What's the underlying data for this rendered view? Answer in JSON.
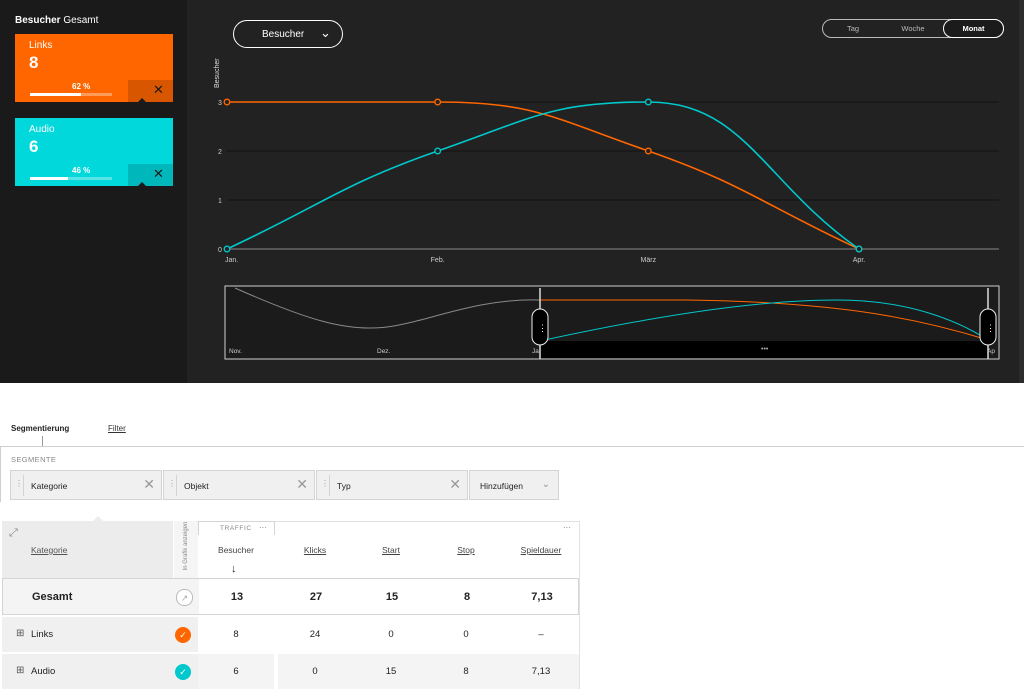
{
  "sidebar": {
    "title_bold": "Besucher",
    "title_rest": "Gesamt",
    "cards": [
      {
        "title": "Links",
        "count": "8",
        "percent": "62 %",
        "fill": 0.62,
        "color": "#ff6600",
        "dark": "#d95600"
      },
      {
        "title": "Audio",
        "count": "6",
        "percent": "46 %",
        "fill": 0.46,
        "color": "#00d8dc",
        "dark": "#00b7bb"
      }
    ]
  },
  "metric_dropdown": {
    "label": "Besucher"
  },
  "period": {
    "options": [
      "Tag",
      "Woche",
      "Monat"
    ],
    "active": "Monat"
  },
  "chart_data": {
    "type": "line",
    "ylabel": "Besucher",
    "categories": [
      "Jan.",
      "Feb.",
      "März",
      "Apr."
    ],
    "ylim": [
      0,
      3
    ],
    "yticks": [
      "0",
      "1",
      "2",
      "3"
    ],
    "series": [
      {
        "name": "Links",
        "color": "#ff6600",
        "values": [
          3,
          3,
          2,
          0
        ]
      },
      {
        "name": "Audio",
        "color": "#00c8cc",
        "values": [
          0,
          2,
          3,
          0
        ]
      }
    ],
    "grid": true
  },
  "navigator": {
    "labels": [
      "Nov.",
      "Dez.",
      "Ja",
      "Ap"
    ],
    "handle_grip": "⋮"
  },
  "tabs": {
    "active": "Segmentierung",
    "other": "Filter"
  },
  "segments": {
    "heading": "SEGMENTE",
    "chips": [
      "Kategorie",
      "Objekt",
      "Typ"
    ],
    "add_label": "Hinzufügen"
  },
  "table": {
    "category_header": "Kategorie",
    "graph_header": "In Grafik anzeigen",
    "group_label": "TRAFFIC",
    "columns": [
      "Besucher",
      "Klicks",
      "Start",
      "Stop",
      "Spieldauer"
    ],
    "sort_arrow": "↓",
    "rows": [
      {
        "name": "Gesamt",
        "values": [
          "13",
          "27",
          "15",
          "8",
          "7,13"
        ]
      },
      {
        "name": "Links",
        "values": [
          "8",
          "24",
          "0",
          "0",
          "–"
        ],
        "color": "#ff6600"
      },
      {
        "name": "Audio",
        "values": [
          "6",
          "0",
          "15",
          "8",
          "7,13"
        ],
        "color": "#00c8cc"
      }
    ]
  }
}
